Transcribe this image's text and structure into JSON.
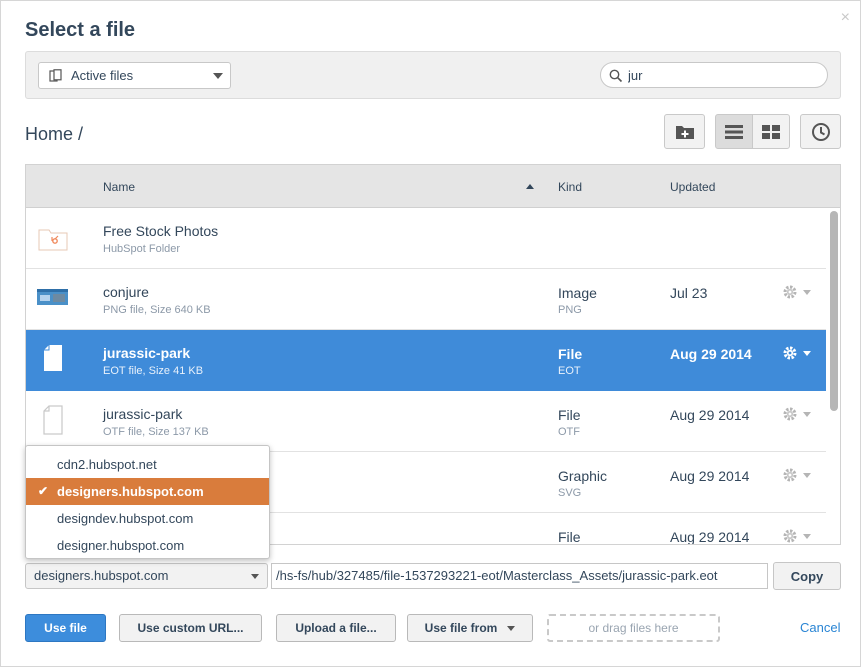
{
  "dialog": {
    "title": "Select a file",
    "close_label": "×"
  },
  "filter": {
    "selected": "Active files",
    "search_value": "jur"
  },
  "breadcrumb": "Home /",
  "table": {
    "headers": {
      "name": "Name",
      "kind": "Kind",
      "updated": "Updated"
    },
    "rows": [
      {
        "name": "Free Stock Photos",
        "meta": "HubSpot Folder",
        "kind": "",
        "kind_sub": "",
        "updated": "",
        "icon": "hubspot-folder-icon"
      },
      {
        "name": "conjure",
        "meta": "PNG file, Size 640 KB",
        "kind": "Image",
        "kind_sub": "PNG",
        "updated": "Jul 23",
        "icon": "image-thumbnail"
      },
      {
        "name": "jurassic-park",
        "meta": "EOT file, Size 41 KB",
        "kind": "File",
        "kind_sub": "EOT",
        "updated": "Aug 29 2014",
        "icon": "file-icon"
      },
      {
        "name": "jurassic-park",
        "meta": "OTF file, Size 137 KB",
        "kind": "File",
        "kind_sub": "OTF",
        "updated": "Aug 29 2014",
        "icon": "file-icon"
      },
      {
        "name": "",
        "meta": "",
        "kind": "Graphic",
        "kind_sub": "SVG",
        "updated": "Aug 29 2014",
        "icon": "file-icon"
      },
      {
        "name": "",
        "meta": "",
        "kind": "File",
        "kind_sub": "",
        "updated": "Aug 29 2014",
        "icon": "file-icon"
      }
    ]
  },
  "domain_dropdown": {
    "options": [
      "cdn2.hubspot.net",
      "designers.hubspot.com",
      "designdev.hubspot.com",
      "designer.hubspot.com"
    ],
    "selected": "designers.hubspot.com",
    "check": "✔"
  },
  "url_bar": {
    "domain": "designers.hubspot.com",
    "path": "/hs-fs/hub/327485/file-1537293221-eot/Masterclass_Assets/jurassic-park.eot",
    "copy_label": "Copy"
  },
  "footer": {
    "use_file": "Use file",
    "use_custom_url": "Use custom URL...",
    "upload": "Upload a file...",
    "use_file_from": "Use file from",
    "drag_hint": "or drag files here",
    "cancel": "Cancel"
  },
  "colors": {
    "selected_row": "#3f8bd9",
    "selected_option": "#d97c3c",
    "primary_button": "#3d8ddc",
    "link": "#2a85d4"
  }
}
